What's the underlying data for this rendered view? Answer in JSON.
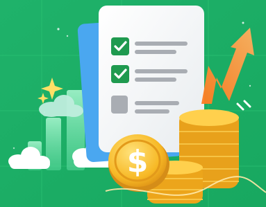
{
  "scene": {
    "colors": {
      "background": "#22b86a",
      "grid": "#2fc779",
      "paper": "#f3f5f7",
      "check": "#1f9a4f",
      "line": "#a9adb3",
      "coin": "#f5b81e",
      "coin_dark": "#d9911a",
      "arrow": "#ff8a2a"
    },
    "checklist": [
      {
        "state": "checked"
      },
      {
        "state": "checked"
      },
      {
        "state": "unchecked"
      }
    ],
    "icons": [
      "checklist-document-icon",
      "dollar-coin-icon",
      "coin-stack-icon",
      "upward-arrow-icon",
      "bar-chart-icon",
      "cloud-icon",
      "sparkle-icon"
    ]
  }
}
